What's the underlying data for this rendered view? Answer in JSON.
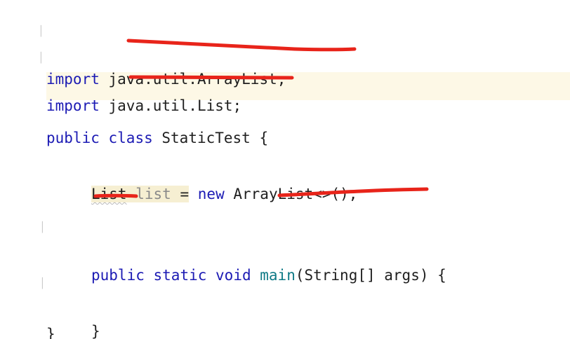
{
  "editor": {
    "line1": {
      "keyword": "import",
      "path": "java.util.ArrayList;"
    },
    "line2": {
      "keyword": "import",
      "path": "java.util.List;"
    },
    "line4": {
      "keyword1": "public",
      "keyword2": "class",
      "class_name": "StaticTest",
      "brace": "{"
    },
    "line6": {
      "type": "List",
      "field": "list",
      "assign": "=",
      "keyword": "new",
      "ctor": "ArrayList<>();"
    },
    "line8": {
      "keyword1": "public",
      "keyword2": "static",
      "keyword3": "void",
      "method": "main",
      "params": "(String[] args) {"
    },
    "line10": {
      "brace": "}"
    },
    "line11": {
      "brace": "}"
    },
    "colors": {
      "keyword": "#1c1bb4",
      "method": "#0f7a86",
      "field": "#8a8a8a",
      "annotation": "#e8241a",
      "current_line": "#fdf8e6",
      "highlight": "#f6efd2"
    }
  }
}
